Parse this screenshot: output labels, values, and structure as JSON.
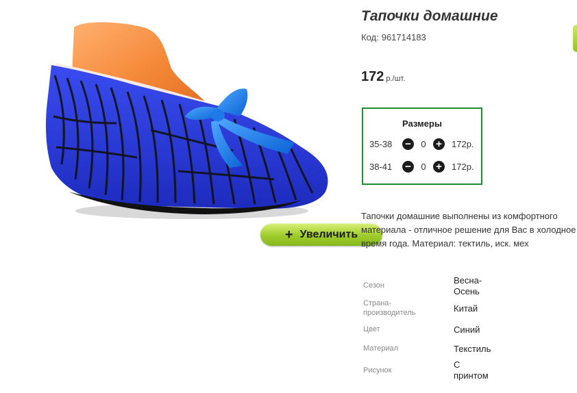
{
  "product": {
    "title": "Тапочки домашние",
    "code_label": "Код:",
    "code_value": "961714183",
    "price_amount": "172",
    "price_unit": "р./шт."
  },
  "zoom_button": {
    "label": "Увеличить"
  },
  "sizes": {
    "title": "Размеры",
    "rows": [
      {
        "size": "35-38",
        "qty": "0",
        "price": "172р."
      },
      {
        "size": "38-41",
        "qty": "0",
        "price": "172р."
      }
    ]
  },
  "description": "Тапочки домашние выполнены из комфортного материала - отличное решение для Вас в холодное время года. Материал: тектиль, иск. мех",
  "specs": [
    {
      "label": "Сезон",
      "value": "Весна-Осень"
    },
    {
      "label": "Страна-производитель",
      "value": "Китай"
    },
    {
      "label": "Цвет",
      "value": "Синий"
    },
    {
      "label": "Материал",
      "value": "Текстиль"
    },
    {
      "label": "Рисунок",
      "value": "С принтом"
    }
  ],
  "colors": {
    "accent_green": "#1a8f2d",
    "button_green": "#9fcc2b",
    "slipper_blue": "#2b3fe0"
  }
}
